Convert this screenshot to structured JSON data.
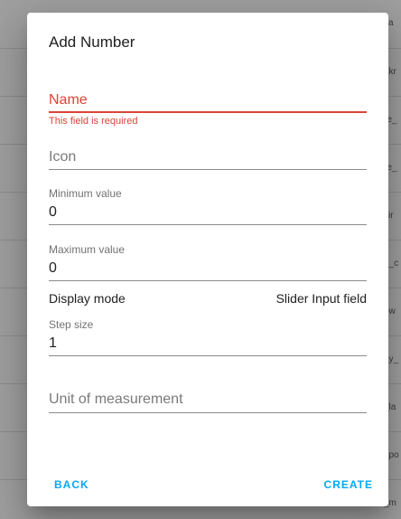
{
  "background": {
    "snippets": [
      "ka",
      "akr",
      "re_",
      "re_",
      "sir",
      "e_c",
      "ow",
      "ay_",
      "_la",
      "_po",
      "_m"
    ]
  },
  "dialog": {
    "title": "Add Number",
    "fields": {
      "name": {
        "label": "Name",
        "error": "This field is required"
      },
      "icon": {
        "placeholder": "Icon"
      },
      "min": {
        "label": "Minimum value",
        "value": "0"
      },
      "max": {
        "label": "Maximum value",
        "value": "0"
      },
      "step": {
        "label": "Step size",
        "value": "1"
      },
      "unit": {
        "placeholder": "Unit of measurement"
      }
    },
    "display_mode": {
      "label": "Display mode",
      "value": "Slider Input field"
    },
    "actions": {
      "back": "BACK",
      "create": "CREATE"
    }
  },
  "colors": {
    "error": "#db4437",
    "accent": "#03a9f4",
    "backdrop": "#9f9f9f"
  }
}
